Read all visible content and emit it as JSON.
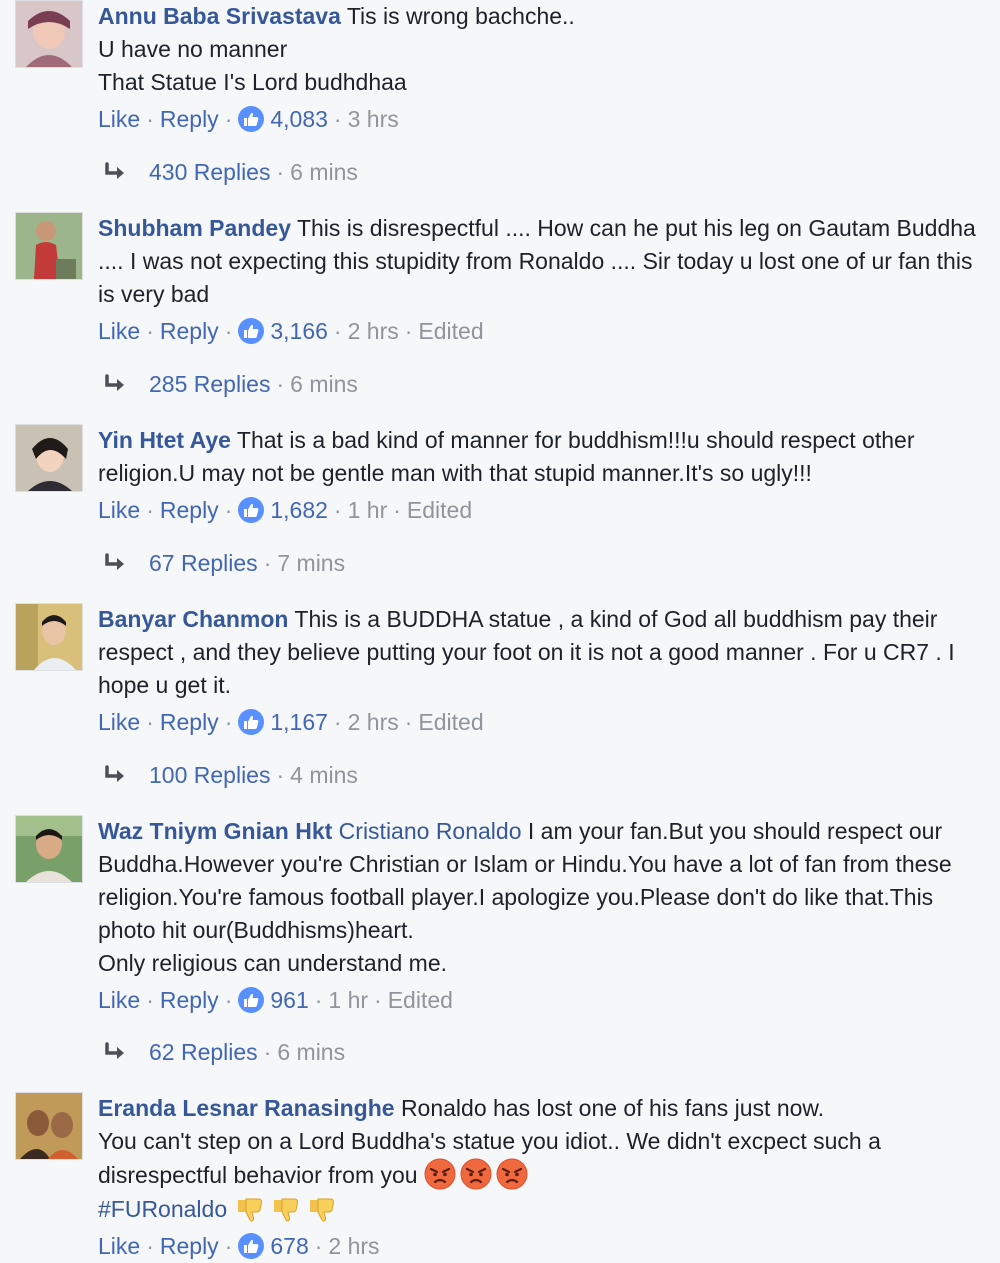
{
  "comments": [
    {
      "author": "Annu Baba Srivastava",
      "text": "Tis is wrong bachche..\nU have no manner\nThat Statue I's Lord budhdhaa",
      "like_label": "Like",
      "reply_label": "Reply",
      "likes": "4,083",
      "time": "3 hrs",
      "edited": "",
      "replies": "430 Replies",
      "reply_time": "6 mins"
    },
    {
      "author": "Shubham Pandey",
      "text": "This is disrespectful .... How can he put his leg on Gautam Buddha .... I was not expecting this stupidity from Ronaldo .... Sir today u lost one of ur fan this is very bad",
      "like_label": "Like",
      "reply_label": "Reply",
      "likes": "3,166",
      "time": "2 hrs",
      "edited": "Edited",
      "replies": "285 Replies",
      "reply_time": "6 mins"
    },
    {
      "author": "Yin Htet Aye",
      "text": "That is a bad kind of manner for buddhism!!!u should respect other religion.U may not be gentle man with that stupid manner.It's so ugly!!!",
      "like_label": "Like",
      "reply_label": "Reply",
      "likes": "1,682",
      "time": "1 hr",
      "edited": "Edited",
      "replies": "67 Replies",
      "reply_time": "7 mins"
    },
    {
      "author": "Banyar Chanmon",
      "text": "This is a BUDDHA statue , a kind of God all buddhism pay their respect , and they believe putting your foot on it is not a good manner . For u CR7 . I hope u get it.",
      "like_label": "Like",
      "reply_label": "Reply",
      "likes": "1,167",
      "time": "2 hrs",
      "edited": "Edited",
      "replies": "100 Replies",
      "reply_time": "4 mins"
    },
    {
      "author": "Waz Tniym Gnian Hkt",
      "mention": "Cristiano Ronaldo",
      "text": "I am your fan.But you should respect our Buddha.However you're Christian or Islam or Hindu.You have a lot of fan from these religion.You're famous football player.I apologize you.Please don't do like that.This photo hit our(Buddhisms)heart.\nOnly religious can understand me.",
      "like_label": "Like",
      "reply_label": "Reply",
      "likes": "961",
      "time": "1 hr",
      "edited": "Edited",
      "replies": "62 Replies",
      "reply_time": "6 mins"
    },
    {
      "author": "Eranda Lesnar Ranasinghe",
      "text": "Ronaldo has lost one of his fans just now.\nYou can't step on a Lord Buddha's statue you idiot.. We didn't excpect such a disrespectful behavior from you",
      "hashtag": "#FURonaldo",
      "like_label": "Like",
      "reply_label": "Reply",
      "likes": "678",
      "time": "2 hrs",
      "edited": ""
    }
  ],
  "icons": {
    "like": "thumbs-up-icon",
    "reply_arrow": "reply-arrow-icon",
    "angry_emoji": "angry-face-emoji",
    "thumbs_down_emoji": "thumbs-down-emoji"
  },
  "colors": {
    "author": "#365899",
    "link": "#4267b2",
    "meta": "#90949c",
    "like_badge": "#5890ff",
    "background": "#f6f7f9"
  }
}
